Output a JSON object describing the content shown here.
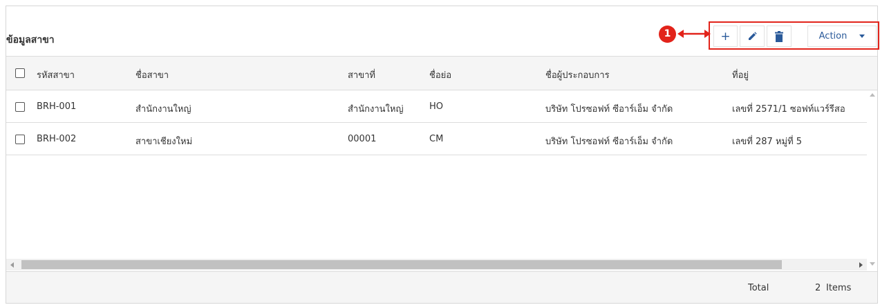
{
  "panel": {
    "title": "ข้อมูลสาขา"
  },
  "callout": {
    "number": "1"
  },
  "toolbar": {
    "add_label": "+",
    "action_label": "Action"
  },
  "table": {
    "columns": [
      "รหัสสาขา",
      "ชื่อสาขา",
      "สาขาที่",
      "ชื่อย่อ",
      "ชื่อผู้ประกอบการ",
      "ที่อยู่"
    ],
    "rows": [
      [
        "BRH-001",
        "สำนักงานใหญ่",
        "สำนักงานใหญ่",
        "HO",
        "บริษัท โปรซอฟท์ ซีอาร์เอ็ม จำกัด",
        "เลขที่ 2571/1 ซอฟท์แวร์รีสอ"
      ],
      [
        "BRH-002",
        "สาขาเชียงใหม่",
        "00001",
        "CM",
        "บริษัท โปรซอฟท์ ซีอาร์เอ็ม จำกัด",
        "เลขที่ 287 หมู่ที่ 5"
      ]
    ]
  },
  "footer": {
    "total_label": "Total",
    "total_count": "2",
    "total_unit": "Items"
  },
  "colors": {
    "accent": "#2a5a9a",
    "callout_red": "#e2231a",
    "header_bg": "#f5f5f5"
  },
  "icons": {
    "add": "plus-icon",
    "edit": "pencil-icon",
    "delete": "trash-icon",
    "dropdown": "caret-down-icon",
    "arrow": "double-arrow-icon"
  }
}
